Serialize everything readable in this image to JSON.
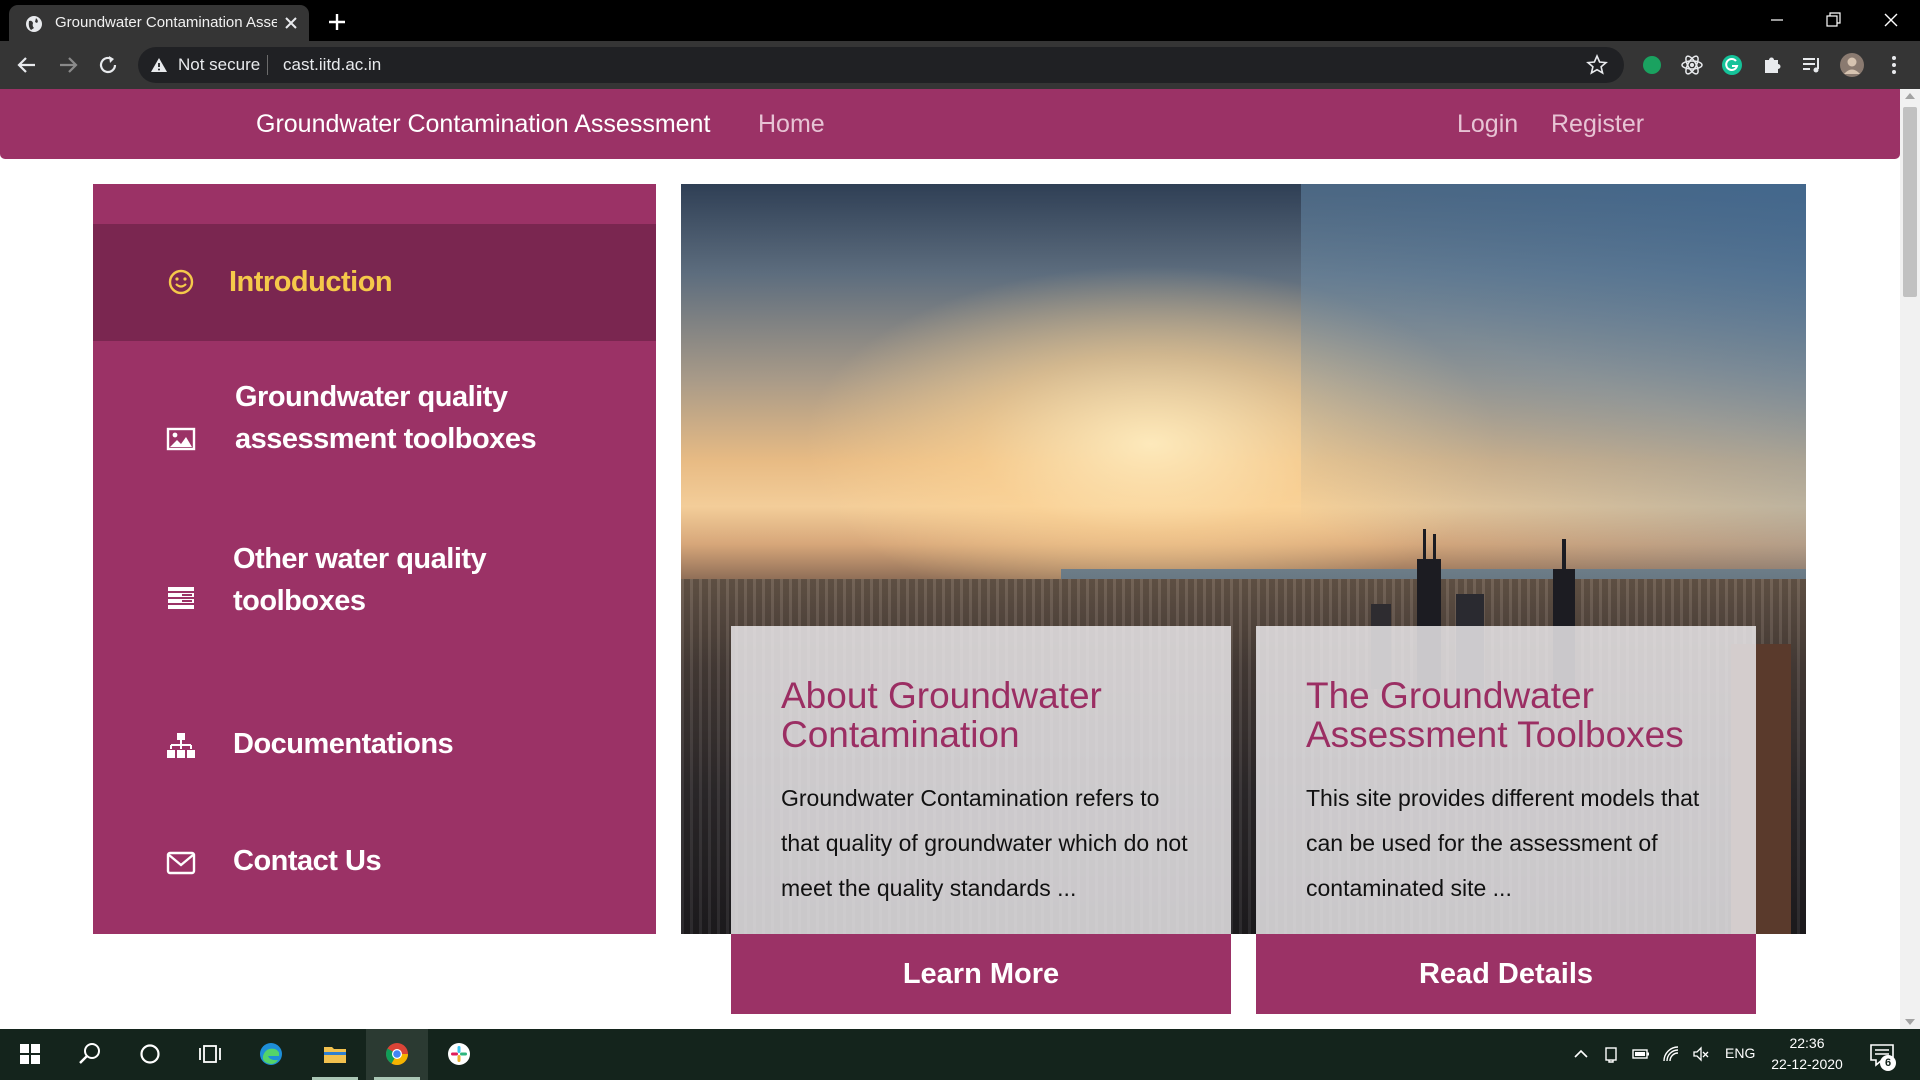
{
  "browser": {
    "tab_title": "Groundwater Contamination Assessment",
    "security_label": "Not secure",
    "url": "cast.iitd.ac.in"
  },
  "site": {
    "brand": "Groundwater Contamination Assessment",
    "nav": {
      "home": "Home",
      "login": "Login",
      "register": "Register"
    },
    "accent_color": "#9b3266",
    "active_color": "#f5c94a",
    "sidebar": [
      {
        "label": "Introduction",
        "icon": "smile-icon",
        "active": true
      },
      {
        "label": "Groundwater quality assessment toolboxes",
        "icon": "image-icon",
        "active": false
      },
      {
        "label": "Other water quality toolboxes",
        "icon": "list-icon",
        "active": false
      },
      {
        "label": "Documentations",
        "icon": "sitemap-icon",
        "active": false
      },
      {
        "label": "Contact Us",
        "icon": "envelope-icon",
        "active": false
      }
    ],
    "cards": [
      {
        "title": "About Groundwater Contamination",
        "text": "Groundwater Contamination refers to that quality of groundwater which do not meet the quality standards ...",
        "button": "Learn More"
      },
      {
        "title": "The Groundwater Assessment Toolboxes",
        "text": "This site provides different models that can be used for the assessment of contaminated site ...",
        "button": "Read Details"
      }
    ]
  },
  "taskbar": {
    "language": "ENG",
    "time": "22:36",
    "date": "22-12-2020",
    "notification_count": "6"
  }
}
